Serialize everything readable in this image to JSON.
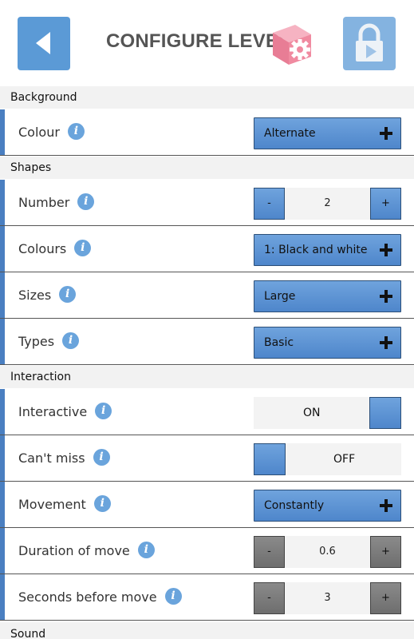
{
  "header": {
    "title": "CONFIGURE LEVEL",
    "back_icon": "back-arrow-icon",
    "lock_icon": "padlock-icon",
    "title_icon": "gear-cube-icon"
  },
  "sections": {
    "background": {
      "title": "Background",
      "colour": {
        "label": "Colour",
        "value": "Alternate"
      }
    },
    "shapes": {
      "title": "Shapes",
      "number": {
        "label": "Number",
        "value": "2",
        "minus": "-",
        "plus": "+"
      },
      "colours": {
        "label": "Colours",
        "value": "1: Black and white"
      },
      "sizes": {
        "label": "Sizes",
        "value": "Large"
      },
      "types": {
        "label": "Types",
        "value": "Basic"
      }
    },
    "interaction": {
      "title": "Interaction",
      "interactive": {
        "label": "Interactive",
        "value": "ON"
      },
      "cant_miss": {
        "label": "Can't miss",
        "value": "OFF"
      },
      "movement": {
        "label": "Movement",
        "value": "Constantly"
      },
      "duration": {
        "label": "Duration of move",
        "value": "0.6",
        "minus": "-",
        "plus": "+"
      },
      "seconds": {
        "label": "Seconds before move",
        "value": "3",
        "minus": "-",
        "plus": "+"
      }
    },
    "sound": {
      "title": "Sound"
    }
  },
  "info_glyph": "i",
  "colors": {
    "accent": "#5b9ad6",
    "row_bar": "#4a7fc1",
    "section_bg": "#f2f2f2",
    "title": "#555555",
    "cube": "#f08aa0"
  }
}
